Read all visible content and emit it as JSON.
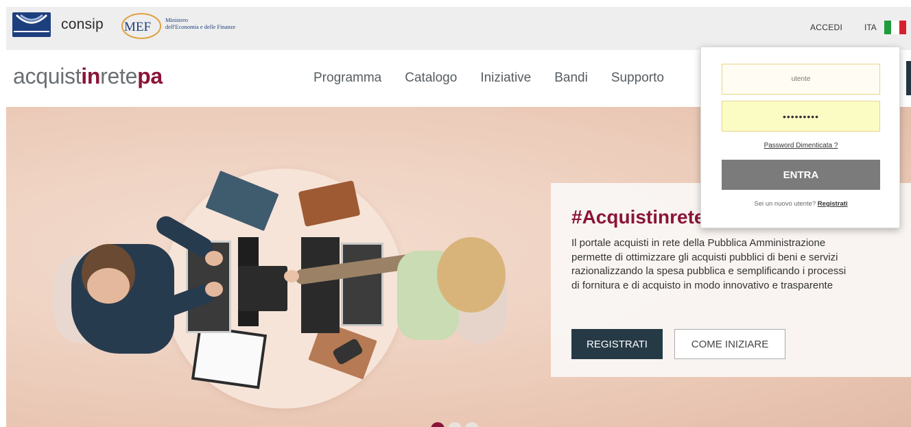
{
  "header": {
    "consip_text": "consip",
    "mef_text": "MEF",
    "mef_line1": "Ministero",
    "mef_line2": "dell'Economia e delle Finanze",
    "accedi": "ACCEDI",
    "lang": "ITA",
    "flag_colors": [
      "#1f9b3c",
      "#ffffff",
      "#d5202e"
    ]
  },
  "nav": {
    "brand_part1": "acquist",
    "brand_part2": "in",
    "brand_part3": "rete",
    "brand_part4": "pa",
    "items": [
      {
        "label": "Programma"
      },
      {
        "label": "Catalogo"
      },
      {
        "label": "Iniziative"
      },
      {
        "label": "Bandi"
      },
      {
        "label": "Supporto"
      }
    ]
  },
  "hero": {
    "title": "#Acquistinrete",
    "text": "Il portale acquisti in rete della Pubblica Amministrazione permette di ottimizzare gli acquisti pubblici di beni e servizi razionalizzando la spesa pubblica e semplificando i processi di fornitura e di acquisto in modo innovativo e trasparente",
    "register_button": "REGISTRATI",
    "start_button": "COME INIZIARE",
    "slides_active": 1
  },
  "login": {
    "user_placeholder": "utente",
    "password_value": "•••••••••",
    "forgot": "Password Dimenticata ?",
    "submit": "ENTRA",
    "new_user_text": "Sei un nuovo utente? ",
    "register_link": "Registrati"
  },
  "colors": {
    "brand": "#8a1538",
    "dark": "#263a46"
  }
}
